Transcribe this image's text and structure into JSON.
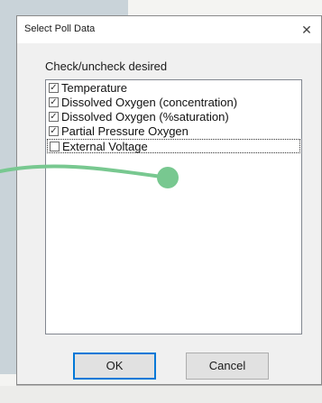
{
  "dialog": {
    "title": "Select Poll Data",
    "close_glyph": "✕",
    "instruction": "Check/uncheck desired",
    "items": [
      {
        "label": "Temperature",
        "checked": true
      },
      {
        "label": "Dissolved Oxygen (concentration)",
        "checked": true
      },
      {
        "label": "Dissolved Oxygen (%saturation)",
        "checked": true
      },
      {
        "label": "Partial Pressure Oxygen",
        "checked": true
      },
      {
        "label": "External Voltage",
        "checked": false
      }
    ],
    "ok_label": "OK",
    "cancel_label": "Cancel"
  },
  "icons": {
    "close": "close-icon",
    "checkbox": "checkbox-icon"
  },
  "colors": {
    "accent": "#0078d7",
    "annotation": "#78c890"
  }
}
